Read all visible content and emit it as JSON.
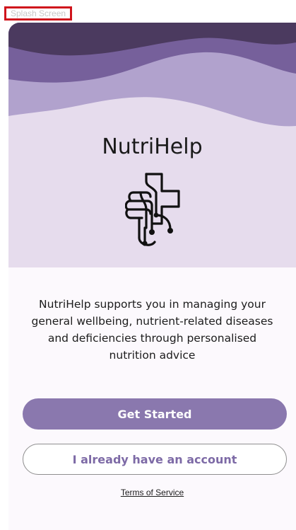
{
  "frame": {
    "label": "Splash Screen"
  },
  "app": {
    "title": "NutriHelp",
    "description": "NutriHelp supports you in managing your general wellbeing, nutrient-related diseases and deficiencies through personalised nutrition advice"
  },
  "actions": {
    "get_started_label": "Get Started",
    "have_account_label": "I already have an account",
    "terms_label": "Terms of Service"
  },
  "icons": {
    "logo": "circuit-cross-hand-icon"
  },
  "colors": {
    "primary": "#8a78ae",
    "secondary_text": "#7d6aa6",
    "hero_background": "#e6dced",
    "wave_dark": "#4b3a5f",
    "wave_mid": "#76609b",
    "wave_light": "#b1a2cd",
    "frame_label_border": "#d0141c"
  }
}
